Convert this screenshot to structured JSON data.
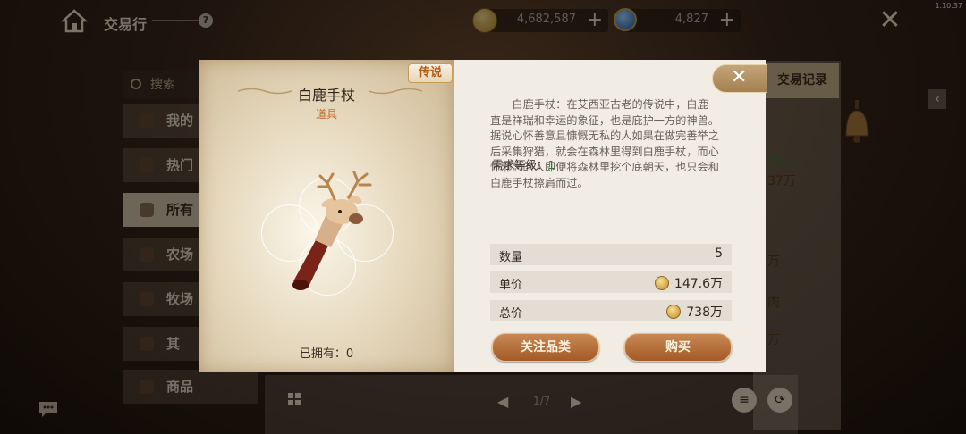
{
  "version": "1.10.37",
  "header": {
    "title": "交易行",
    "help_label": "?",
    "coins": "4,682,587",
    "gems": "4,827",
    "plus": "+",
    "close": "✕"
  },
  "sidebar": {
    "search_placeholder": "搜索",
    "items": [
      {
        "label": "我的"
      },
      {
        "label": "热门"
      },
      {
        "label": "所有"
      },
      {
        "label": "农场"
      },
      {
        "label": "牧场"
      },
      {
        "label": "其"
      },
      {
        "label": "商品"
      }
    ]
  },
  "right": {
    "record_tab": "交易记录",
    "fragments": [
      "75万",
      "37万",
      "万",
      "肉",
      "万"
    ]
  },
  "pager": {
    "prev": "◀",
    "next": "▶",
    "text": "1/7"
  },
  "modal": {
    "rarity": "传说",
    "name": "白鹿手杖",
    "type": "道具",
    "owned_label": "已拥有：",
    "owned_value": "0",
    "close": "✕",
    "description": "白鹿手杖：在艾西亚古老的传说中，白鹿一直是祥瑞和幸运的象征，也是庇护一方的神兽。据说心怀善意且慷慨无私的人如果在做完善举之后采集狩猎，就会在森林里得到白鹿手杖，而心怀邪念的人即便将森林里挖个底朝天，也只会和白鹿手杖擦肩而过。",
    "req_label": "需求等级：",
    "req_value": "1",
    "rows": {
      "qty_label": "数量",
      "qty_value": "5",
      "unit_label": "单价",
      "unit_value": "147.6万",
      "total_label": "总价",
      "total_value": "738万"
    },
    "follow_button": "关注品类",
    "buy_button": "购买"
  }
}
